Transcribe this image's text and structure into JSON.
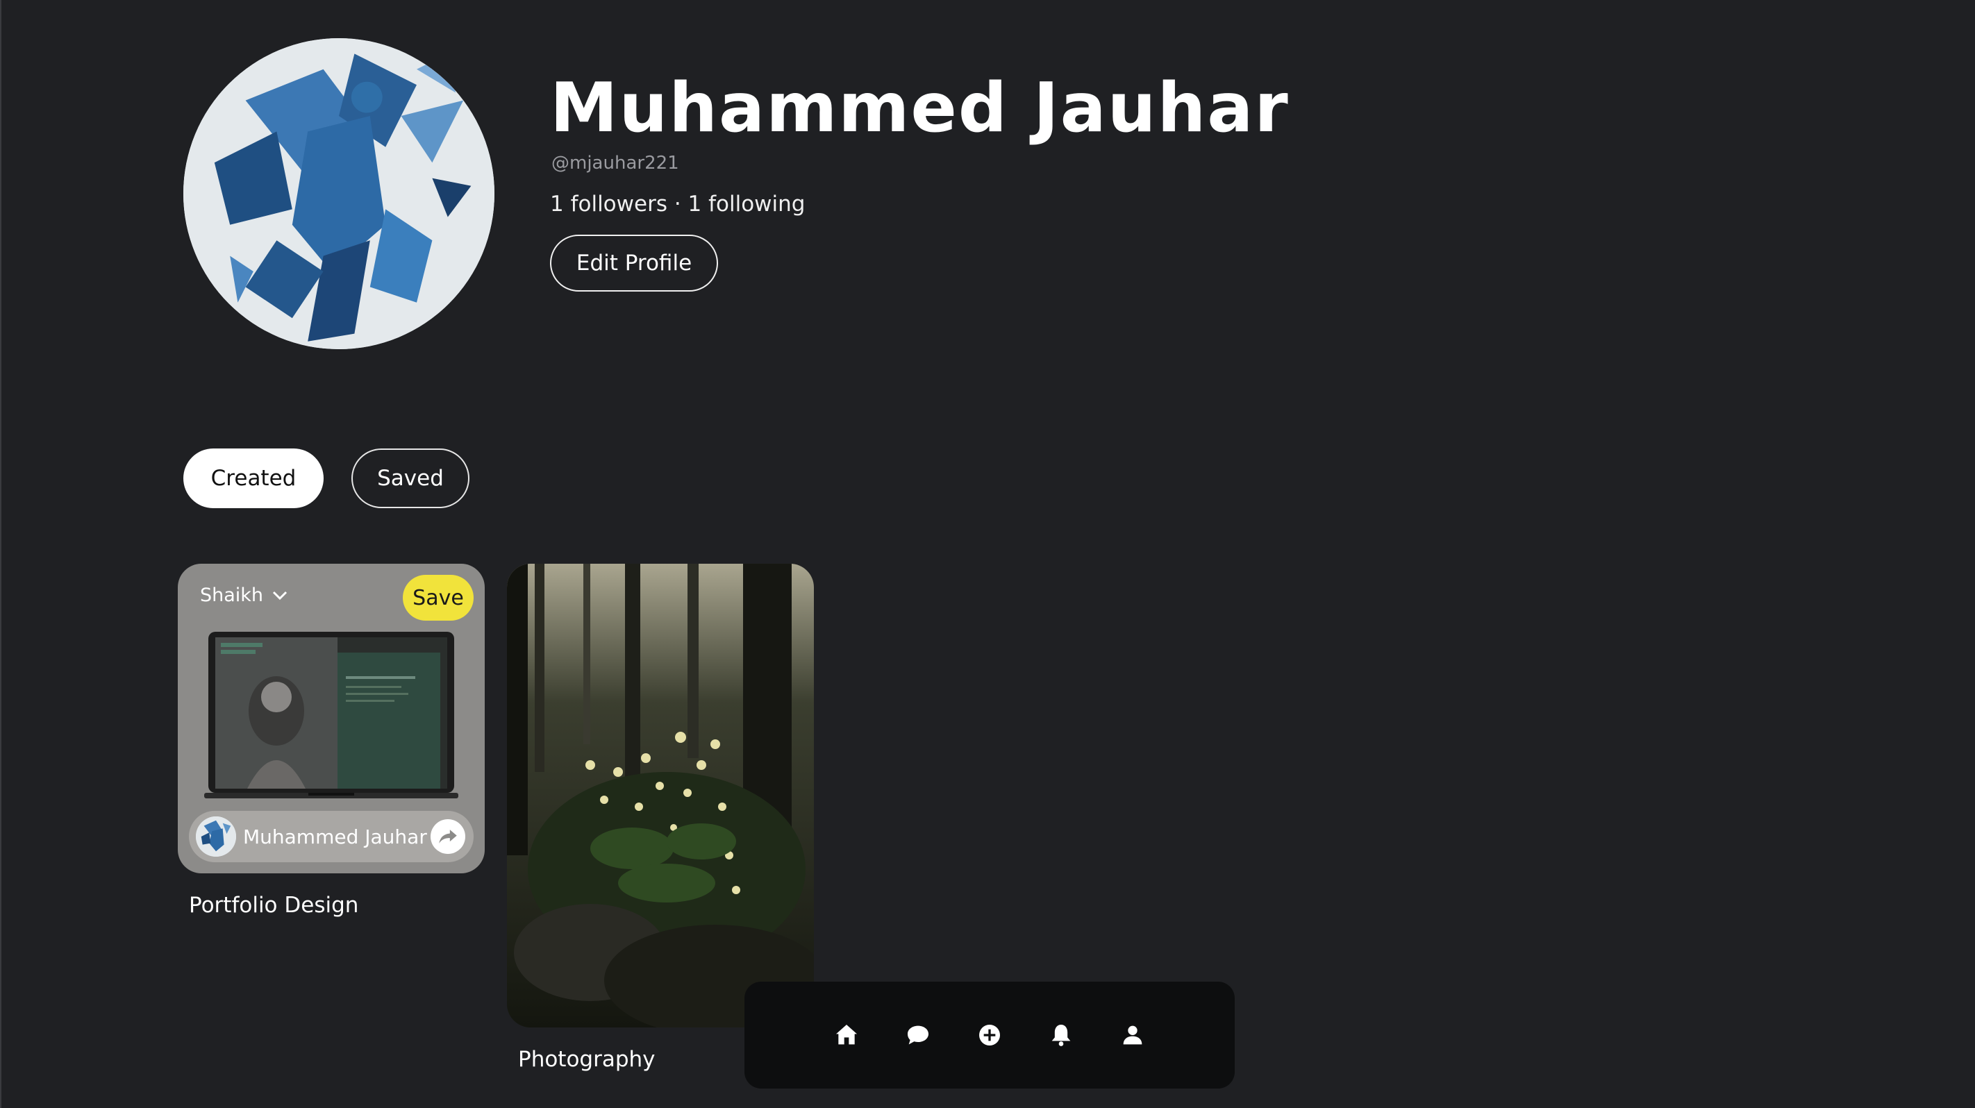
{
  "profile": {
    "name": "Muhammed Jauhar",
    "handle": "@mjauhar221",
    "stats": "1 followers · 1 following",
    "edit_label": "Edit Profile",
    "avatar_icon": "user-avatar-blue-crystal-figure"
  },
  "tabs": [
    {
      "label": "Created",
      "active": true
    },
    {
      "label": "Saved",
      "active": false
    }
  ],
  "pins": [
    {
      "title": "Portfolio Design",
      "board": "Shaikh",
      "save_label": "Save",
      "author": "Muhammed Jauhar",
      "share_icon": "share-arrow-icon"
    },
    {
      "title": "Photography",
      "image": "forest-wildflowers-photo"
    }
  ],
  "bottom_nav": {
    "items": [
      {
        "name": "home",
        "icon": "home-icon"
      },
      {
        "name": "messages",
        "icon": "chat-bubble-icon"
      },
      {
        "name": "create",
        "icon": "plus-circle-icon"
      },
      {
        "name": "notifications",
        "icon": "bell-icon"
      },
      {
        "name": "profile",
        "icon": "person-icon"
      }
    ]
  },
  "colors": {
    "background": "#1f2023",
    "save_button": "#f1e33b",
    "nav_bar": "#0d0e0f",
    "avatar_blue": "#2f6fa8"
  }
}
